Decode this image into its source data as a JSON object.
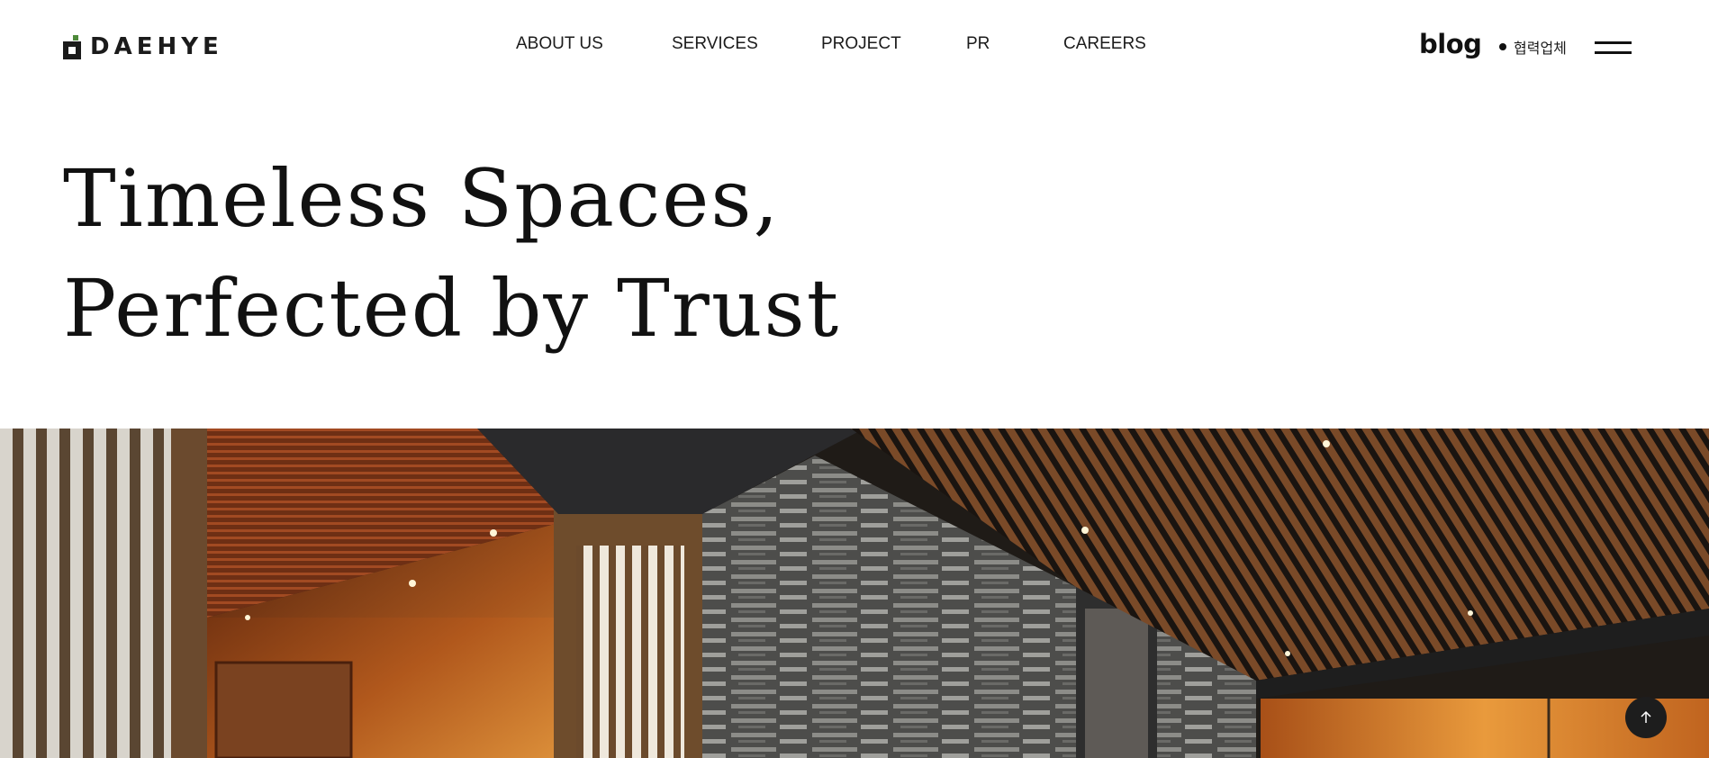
{
  "brand": {
    "name": "DAEHYE"
  },
  "nav": {
    "items": [
      {
        "label": "ABOUT US"
      },
      {
        "label": "SERVICES"
      },
      {
        "label": "PROJECT"
      },
      {
        "label": "PR"
      },
      {
        "label": "CAREERS"
      }
    ]
  },
  "header_right": {
    "blog_label": "blog",
    "partner_label": "협력업체",
    "menu_icon": "hamburger-menu-icon"
  },
  "hero": {
    "line1": "Timeless Spaces,",
    "line2": "Perfected by Trust"
  },
  "scroll_top": {
    "icon": "arrow-up-icon"
  },
  "colors": {
    "text": "#111111",
    "accent_wood": "#8a4a1e",
    "stone": "#5a5a58"
  }
}
